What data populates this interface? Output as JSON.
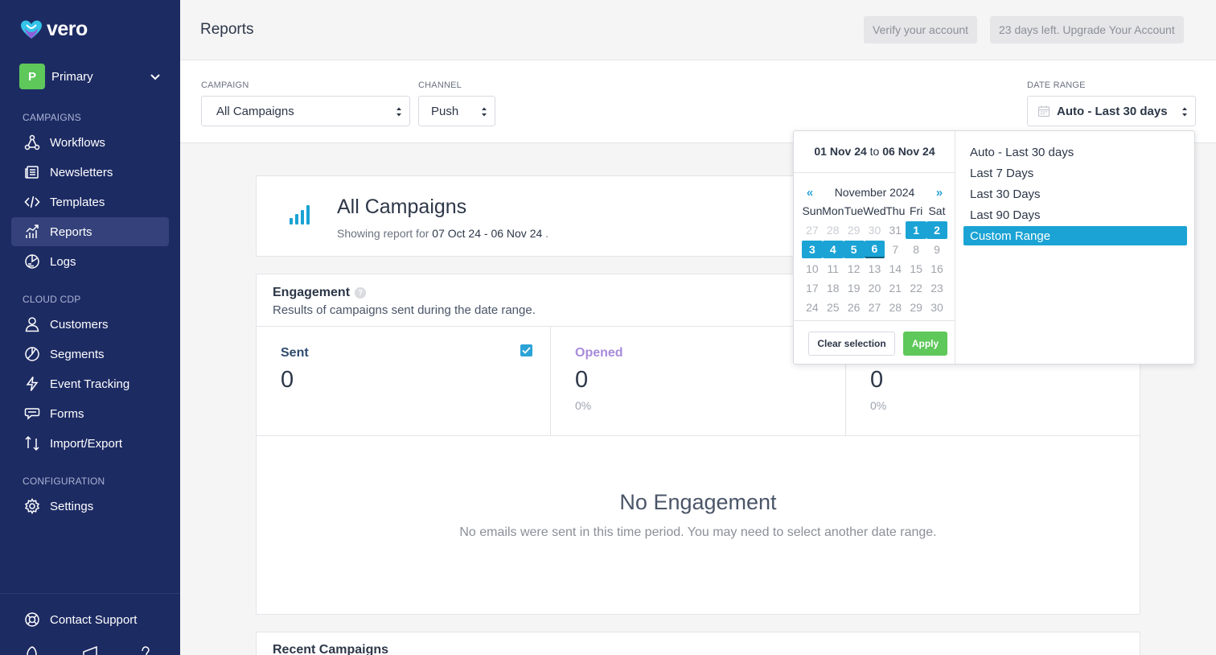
{
  "brand": {
    "name": "vero"
  },
  "workspace": {
    "initial": "P",
    "name": "Primary"
  },
  "sidebar": {
    "sections": [
      {
        "label": "CAMPAIGNS"
      },
      {
        "label": "CLOUD CDP"
      },
      {
        "label": "CONFIGURATION"
      }
    ],
    "items": [
      {
        "label": "Workflows",
        "icon": "workflows-icon"
      },
      {
        "label": "Newsletters",
        "icon": "newsletters-icon"
      },
      {
        "label": "Templates",
        "icon": "code-icon"
      },
      {
        "label": "Reports",
        "icon": "chart-icon",
        "active": true
      },
      {
        "label": "Logs",
        "icon": "logs-icon"
      },
      {
        "label": "Customers",
        "icon": "user-icon"
      },
      {
        "label": "Segments",
        "icon": "segments-icon"
      },
      {
        "label": "Event Tracking",
        "icon": "bolt-icon"
      },
      {
        "label": "Forms",
        "icon": "forms-icon"
      },
      {
        "label": "Import/Export",
        "icon": "import-export-icon"
      },
      {
        "label": "Settings",
        "icon": "gear-icon"
      }
    ],
    "support": {
      "label": "Contact Support",
      "icon": "lifebuoy-icon"
    }
  },
  "header": {
    "title": "Reports",
    "verify_label": "Verify your account",
    "upgrade_label": "23 days left. Upgrade Your Account"
  },
  "filters": {
    "campaign": {
      "label": "CAMPAIGN",
      "value": "All Campaigns"
    },
    "channel": {
      "label": "CHANNEL",
      "value": "Push"
    },
    "date_range": {
      "label": "DATE RANGE",
      "value": "Auto - Last 30 days"
    }
  },
  "campaign_card": {
    "title": "All Campaigns",
    "subtitle_prefix": "Showing report for",
    "subtitle_range": "07 Oct 24 - 06 Nov 24",
    "subtitle_suffix": "."
  },
  "engagement": {
    "title": "Engagement",
    "help": "?",
    "subtitle": "Results of campaigns sent during the date range.",
    "metrics": [
      {
        "label": "Sent",
        "value": "0",
        "percent": "",
        "color": "#2d4a6e",
        "checked": true
      },
      {
        "label": "Opened",
        "value": "0",
        "percent": "0%",
        "color": "#a78bdb"
      },
      {
        "label": "",
        "value": "0",
        "percent": "0%",
        "color": "#2d3748"
      }
    ],
    "empty_title": "No Engagement",
    "empty_subtitle": "No emails were sent in this time period. You may need to select another date range."
  },
  "recent": {
    "title": "Recent Campaigns"
  },
  "datepicker": {
    "from": "01 Nov 24",
    "to_word": "to",
    "to": "06 Nov 24",
    "month_title": "November 2024",
    "prev": "«",
    "next": "»",
    "weekdays": [
      "Sun",
      "Mon",
      "Tue",
      "Wed",
      "Thu",
      "Fri",
      "Sat"
    ],
    "weeks": [
      [
        "27",
        "28",
        "29",
        "30",
        "31",
        "1",
        "2"
      ],
      [
        "3",
        "4",
        "5",
        "6",
        "7",
        "8",
        "9"
      ],
      [
        "10",
        "11",
        "12",
        "13",
        "14",
        "15",
        "16"
      ],
      [
        "17",
        "18",
        "19",
        "20",
        "21",
        "22",
        "23"
      ],
      [
        "24",
        "25",
        "26",
        "27",
        "28",
        "29",
        "30"
      ]
    ],
    "clear_label": "Clear selection",
    "apply_label": "Apply",
    "presets": [
      {
        "label": "Auto - Last 30 days"
      },
      {
        "label": "Last 7 Days"
      },
      {
        "label": "Last 30 Days"
      },
      {
        "label": "Last 90 Days"
      },
      {
        "label": "Custom Range",
        "active": true
      }
    ]
  },
  "colors": {
    "sidebar": "#1d2b63",
    "accent": "#1aa3d4",
    "green": "#5ec85a"
  }
}
